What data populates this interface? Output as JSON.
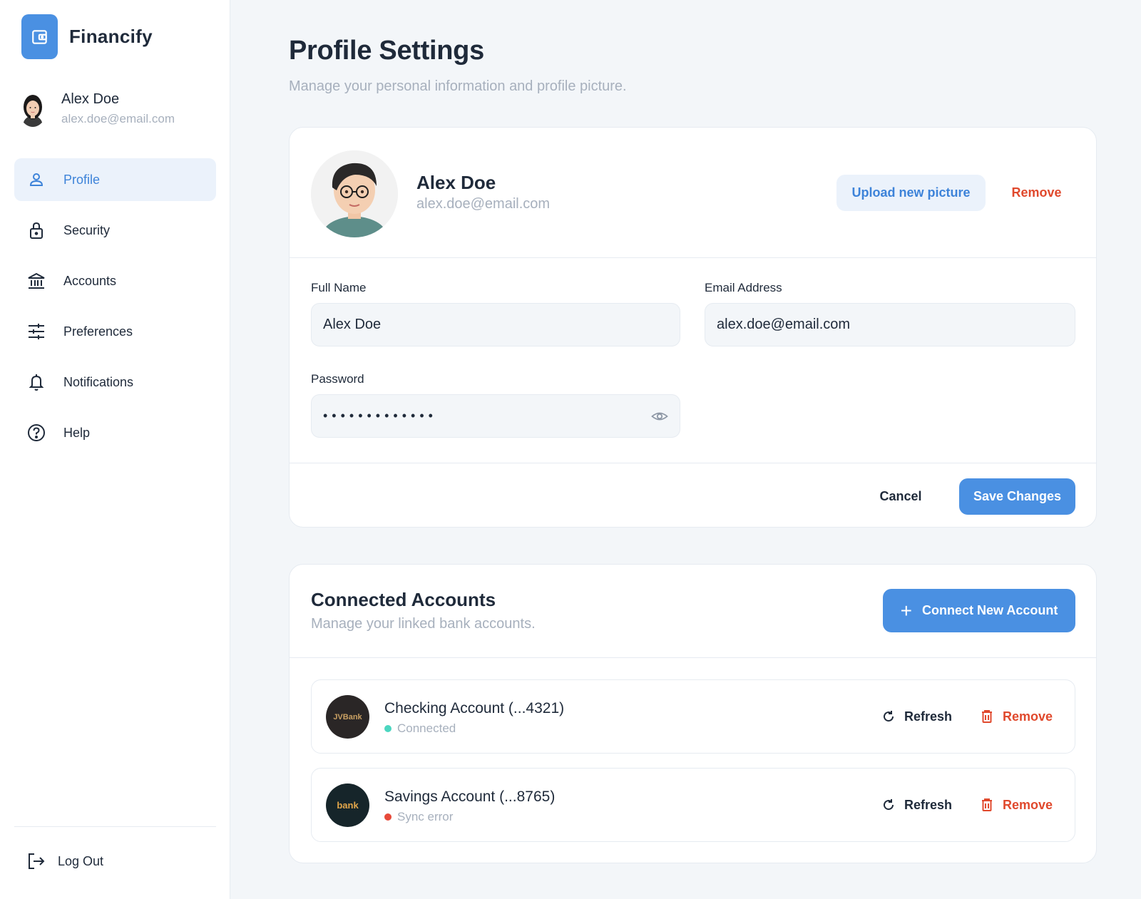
{
  "brand": {
    "name": "Financify",
    "accent": "#4a90e2"
  },
  "user": {
    "name": "Alex Doe",
    "email": "alex.doe@email.com"
  },
  "sidebar": {
    "items": [
      {
        "label": "Profile",
        "icon": "user-icon",
        "active": true
      },
      {
        "label": "Security",
        "icon": "lock-icon",
        "active": false
      },
      {
        "label": "Accounts",
        "icon": "bank-icon",
        "active": false
      },
      {
        "label": "Preferences",
        "icon": "sliders-icon",
        "active": false
      },
      {
        "label": "Notifications",
        "icon": "bell-icon",
        "active": false
      },
      {
        "label": "Help",
        "icon": "help-icon",
        "active": false
      }
    ],
    "logout_label": "Log Out"
  },
  "page": {
    "title": "Profile Settings",
    "subtitle": "Manage your personal information and profile picture."
  },
  "profile_card": {
    "name": "Alex Doe",
    "email": "alex.doe@email.com",
    "upload_label": "Upload new picture",
    "remove_label": "Remove",
    "fields": {
      "full_name": {
        "label": "Full Name",
        "value": "Alex Doe"
      },
      "email": {
        "label": "Email Address",
        "value": "alex.doe@email.com"
      },
      "password": {
        "label": "Password",
        "value": "•••••••••••••"
      }
    },
    "cancel_label": "Cancel",
    "save_label": "Save Changes"
  },
  "accounts": {
    "title": "Connected Accounts",
    "subtitle": "Manage your linked bank accounts.",
    "connect_label": "Connect New Account",
    "items": [
      {
        "name": "Checking Account (...4321)",
        "status": "Connected",
        "status_color": "#4cd6c0",
        "logo_text": "JVBank",
        "logo_bg": "#2a2626",
        "logo_color": "#c9a063",
        "refresh_label": "Refresh",
        "remove_label": "Remove"
      },
      {
        "name": "Savings Account (...8765)",
        "status": "Sync error",
        "status_color": "#e84a3a",
        "logo_text": "bank",
        "logo_bg": "#16252a",
        "logo_color": "#e2a64a",
        "refresh_label": "Refresh",
        "remove_label": "Remove"
      }
    ]
  }
}
